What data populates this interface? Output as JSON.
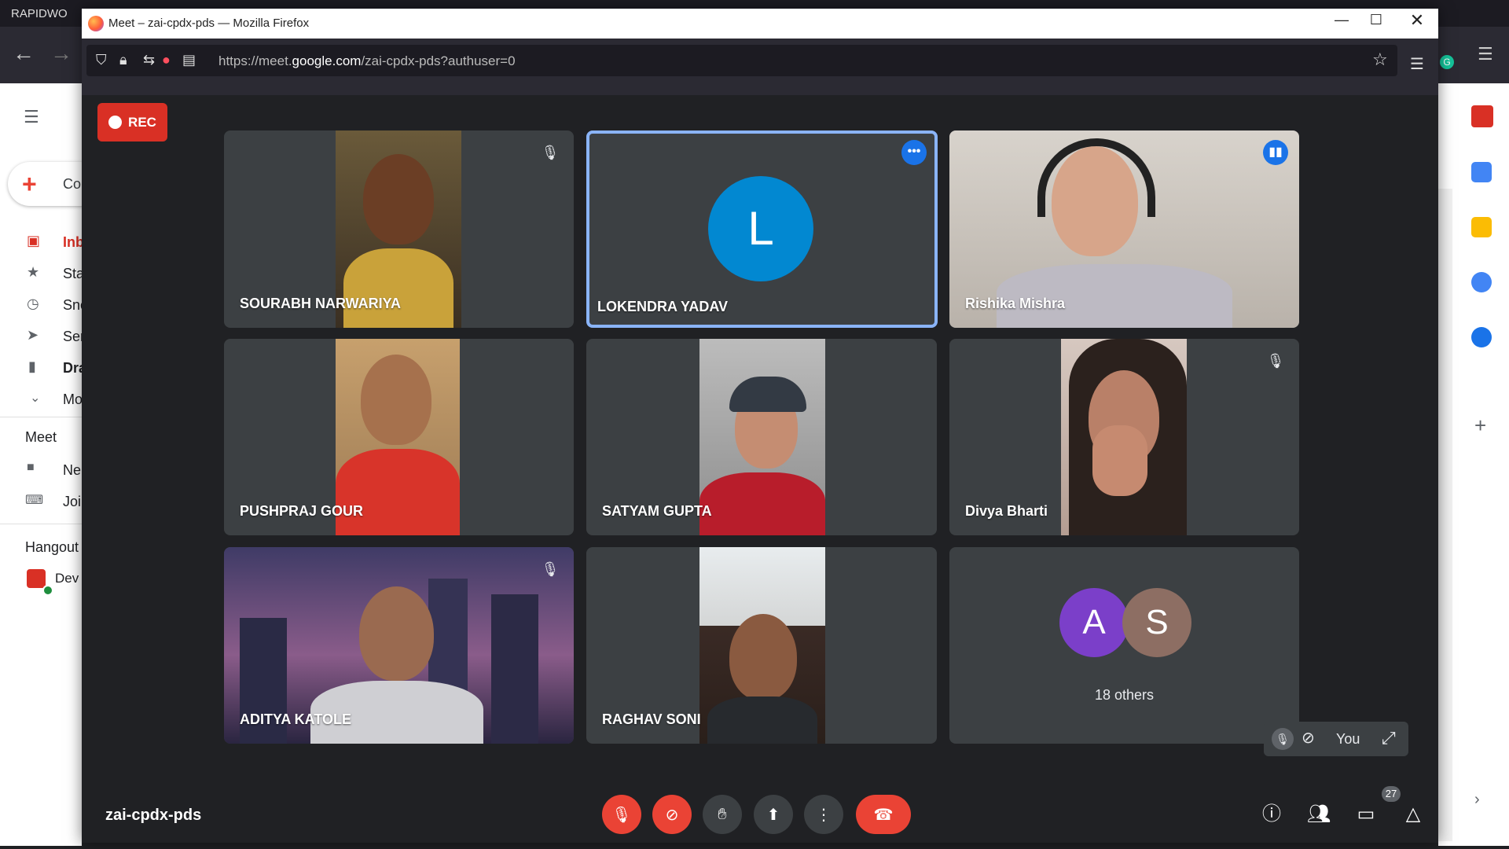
{
  "background_window": {
    "tab_text": "RAPIDWO",
    "gmail_compose": "Co",
    "gmail_items": [
      "Inb",
      "Sta",
      "Sno",
      "Sen",
      "Dra",
      "Mo"
    ],
    "meet_section": "Meet",
    "meet_items": [
      "Ne",
      "Joi"
    ],
    "hangouts_section": "Hangout",
    "hangouts_user": "Dev"
  },
  "firefox": {
    "window_title": "Meet – zai-cpdx-pds — Mozilla Firefox",
    "url_prefix": "https://meet.",
    "url_domain": "google.com",
    "url_path": "/zai-cpdx-pds?authuser=0"
  },
  "meet": {
    "rec_label": "REC",
    "meeting_code": "zai-cpdx-pds",
    "participants_count": "27",
    "tiles": [
      {
        "name": "SOURABH NARWARIYA",
        "muted": true
      },
      {
        "name": "LOKENDRA YADAV",
        "avatar_letter": "L",
        "active": true
      },
      {
        "name": "Rishika Mishra",
        "speaking": true
      },
      {
        "name": "PUSHPRAJ GOUR"
      },
      {
        "name": "SATYAM GUPTA"
      },
      {
        "name": "Divya Bharti",
        "muted": true
      },
      {
        "name": "ADITYA KATOLE",
        "muted": true
      },
      {
        "name": "RAGHAV SONI"
      },
      {
        "name": "18 others",
        "avatar_letters": [
          "A",
          "S"
        ]
      }
    ],
    "self_label": "You"
  },
  "colors": {
    "meet_bg": "#202124",
    "tile_bg": "#3c4043",
    "accent_blue": "#1a73e8",
    "red": "#ea4335"
  }
}
